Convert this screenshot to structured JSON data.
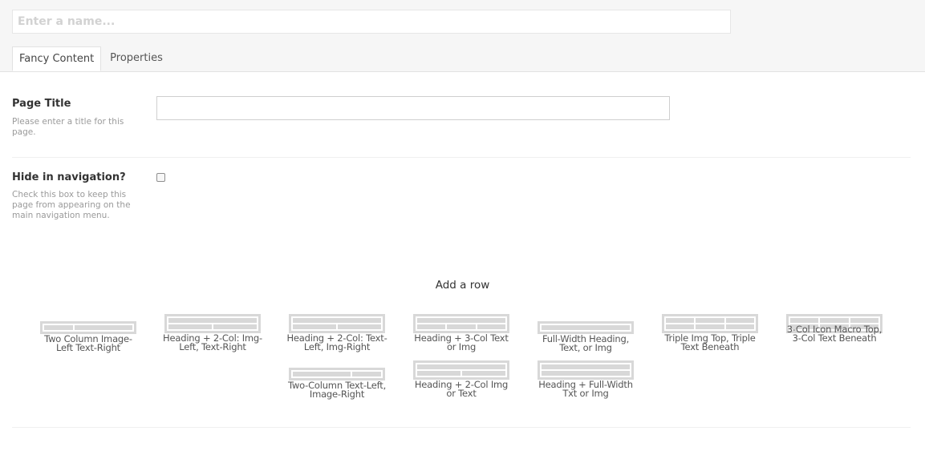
{
  "header": {
    "name_placeholder": "Enter a name...",
    "tabs": [
      {
        "label": "Fancy Content",
        "active": true
      },
      {
        "label": "Properties",
        "active": false
      }
    ]
  },
  "properties": {
    "page_title": {
      "label": "Page Title",
      "description": "Please enter a title for this page.",
      "value": ""
    },
    "hide_nav": {
      "label": "Hide in navigation?",
      "description": "Check this box to keep this page from appearing on the main navigation menu.",
      "checked": false
    }
  },
  "grid": {
    "add_row_label": "Add a row",
    "layouts": [
      {
        "label": "Two Column Image-Left Text-Right"
      },
      {
        "label": "Heading + 2-Col: Img-Left, Text-Right"
      },
      {
        "label": "Heading + 2-Col: Text-Left, Img-Right"
      },
      {
        "label": "Heading + 3-Col Text or Img"
      },
      {
        "label": "Full-Width Heading, Text, or Img"
      },
      {
        "label": "Triple Img Top, Triple Text Beneath"
      },
      {
        "label": "3-Col Icon Macro Top, 3-Col Text Beneath"
      },
      {
        "label": "Two-Column Text-Left, Image-Right"
      },
      {
        "label": "Heading + 2-Col Img or Text"
      },
      {
        "label": "Heading + Full-Width Txt or Img"
      }
    ]
  },
  "colors": {
    "header_bg": "#f6f6f6",
    "thumb_gray": "#d8d8d8",
    "label_text": "#333333",
    "description_text": "#9a9a9a"
  }
}
